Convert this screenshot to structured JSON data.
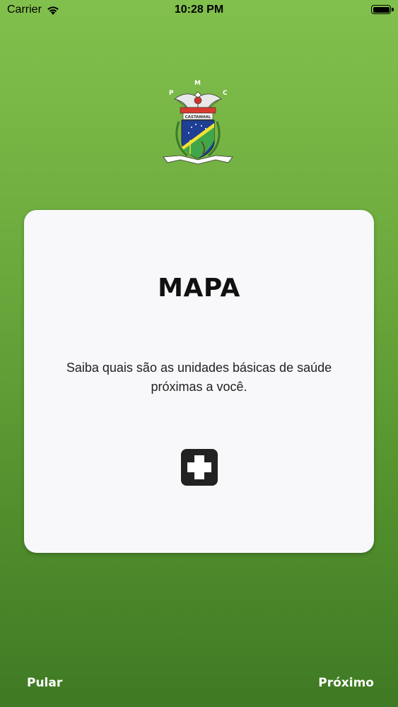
{
  "status_bar": {
    "carrier": "Carrier",
    "time": "10:28 PM",
    "battery_level": 1.0
  },
  "crest": {
    "letters": [
      "P",
      "M",
      "C"
    ],
    "banner_top": "CASTANHAL",
    "icon": "municipal-crest-icon"
  },
  "card": {
    "title": "MAPA",
    "description": "Saiba quais são as unidades básicas de saúde próximas a você.",
    "icon": "medical-cross-icon"
  },
  "footer": {
    "skip_label": "Pular",
    "next_label": "Próximo"
  },
  "colors": {
    "background_top": "#82c04d",
    "background_bottom": "#3f7a24",
    "card_background": "#f8f8fb",
    "button_text": "#ffffff"
  }
}
